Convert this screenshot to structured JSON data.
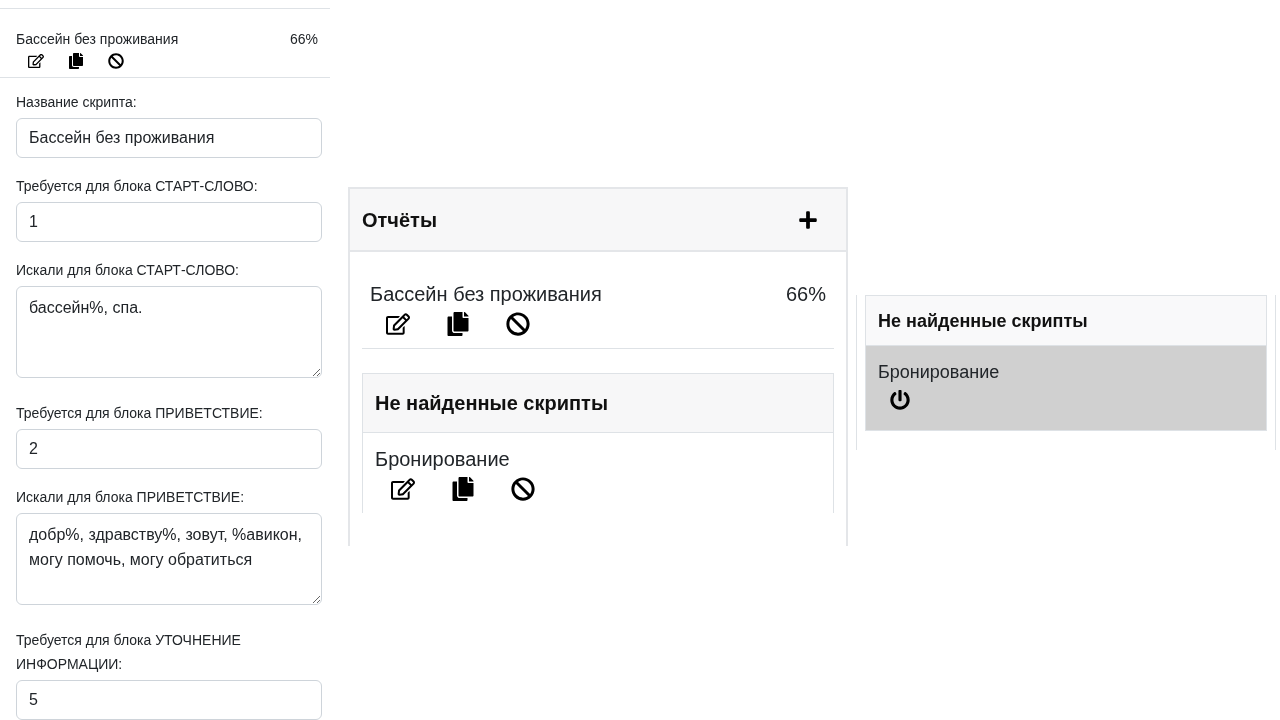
{
  "form_panel": {
    "report": {
      "name": "Бассейн без проживания",
      "percent": "66%"
    },
    "fields": [
      {
        "kind": "input",
        "label": "Название скрипта:",
        "value": "Бассейн без проживания"
      },
      {
        "kind": "input",
        "label": "Требуется для блока СТАРТ-СЛОВО:",
        "value": "1"
      },
      {
        "kind": "textarea",
        "label": "Искали для блока СТАРТ-СЛОВО:",
        "value": "бассейн%, спа."
      },
      {
        "kind": "input",
        "label": "Требуется для блока ПРИВЕТСТВИЕ:",
        "value": "2"
      },
      {
        "kind": "textarea",
        "label": "Искали для блока ПРИВЕТСТВИЕ:",
        "value": "добр%, здравству%, зовут, %авикон, могу помочь, могу обратиться"
      },
      {
        "kind": "input",
        "label": "Требуется для блока УТОЧНЕНИЕ ИНФОРМАЦИИ:",
        "value": "5"
      }
    ]
  },
  "reports_panel": {
    "title": "Отчёты",
    "report": {
      "name": "Бассейн без проживания",
      "percent": "66%"
    },
    "not_found": {
      "title": "Не найденные скрипты",
      "items": [
        {
          "name": "Бронирование",
          "disabled": false
        }
      ]
    }
  },
  "disabled_panel": {
    "title": "Не найденные скрипты",
    "items": [
      {
        "name": "Бронирование",
        "disabled": true
      }
    ]
  }
}
